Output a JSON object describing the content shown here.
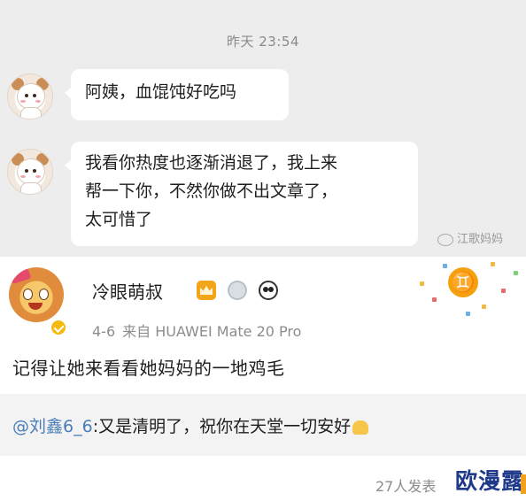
{
  "chat": {
    "timestamp": "昨天 23:54",
    "messages": [
      {
        "text": "阿姨，血馄饨好吃吗"
      },
      {
        "lines": [
          "我看你热度也逐渐消退了，我上来",
          "帮一下你，不然你做不出文章了，",
          "太可惜了"
        ]
      }
    ],
    "watermark": "江歌妈妈"
  },
  "post": {
    "username": "冷眼萌叔",
    "badges": [
      "crown-badge-icon",
      "medal-badge-icon",
      "panda-badge-icon"
    ],
    "zodiac_symbol": "♊",
    "date": "4-6",
    "source": "来自 HUAWEI Mate 20 Pro",
    "comment": "记得让她来看看她妈妈的一地鸡毛",
    "reply": {
      "mention": "@刘鑫6_6",
      "text": ":又是清明了，祝你在天堂一切安好"
    },
    "footer_count": "27人发表",
    "stamp": "欧漫露"
  },
  "colors": {
    "chat_bg": "#ededed",
    "mention": "#4a7cb8",
    "verified": "#f5b90f",
    "stamp": "#1f3a8a"
  }
}
